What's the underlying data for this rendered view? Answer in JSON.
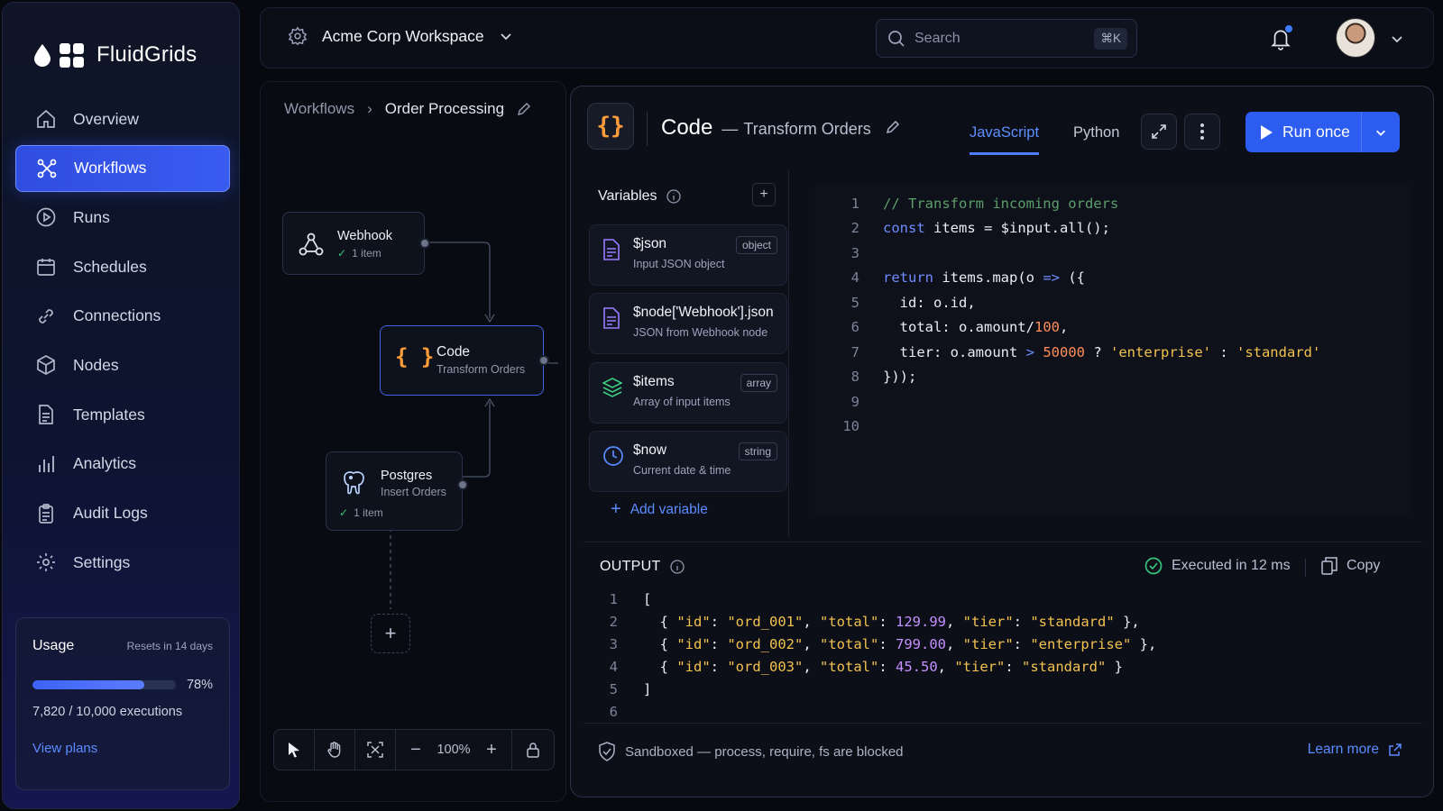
{
  "brand": {
    "name": "FluidGrids"
  },
  "sidebar": {
    "items": [
      {
        "label": "Overview",
        "icon": "home-icon"
      },
      {
        "label": "Workflows",
        "icon": "workflow-icon",
        "active": true
      },
      {
        "label": "Runs",
        "icon": "play-circle-icon"
      },
      {
        "label": "Schedules",
        "icon": "calendar-icon"
      },
      {
        "label": "Connections",
        "icon": "link-icon"
      },
      {
        "label": "Nodes",
        "icon": "cube-icon"
      },
      {
        "label": "Templates",
        "icon": "document-icon"
      },
      {
        "label": "Analytics",
        "icon": "bar-chart-icon"
      },
      {
        "label": "Audit Logs",
        "icon": "clipboard-icon"
      },
      {
        "label": "Settings",
        "icon": "gear-icon"
      }
    ]
  },
  "usage": {
    "title": "Usage",
    "reset": "Resets in 14 days",
    "percent_label": "78%",
    "percent": 0.78,
    "count": "7,820 / 10,000 executions",
    "link": "View plans"
  },
  "topbar": {
    "workspace": "Acme Corp Workspace",
    "search_placeholder": "Search",
    "shortcut": "⌘K"
  },
  "canvas": {
    "breadcrumb": {
      "root": "Workflows",
      "current": "Order Processing"
    },
    "nodes": {
      "webhook": {
        "title": "Webhook",
        "status": "1 item"
      },
      "code": {
        "title": "Code",
        "subtitle": "Transform Orders"
      },
      "postgres": {
        "title": "Postgres",
        "subtitle": "Insert Orders",
        "status": "1 item"
      }
    },
    "zoom": "100%"
  },
  "panel": {
    "title": "Code",
    "dash": "—",
    "subtitle": "Transform Orders",
    "tabs": [
      {
        "label": "JavaScript",
        "active": true
      },
      {
        "label": "Python"
      }
    ],
    "run_label": "Run once",
    "variables": {
      "title": "Variables",
      "items": [
        {
          "name": "$json",
          "desc": "Input JSON object",
          "type": "object",
          "icon": "document-icon"
        },
        {
          "name": "$node['Webhook'].json",
          "desc": "JSON from Webhook node",
          "type": "",
          "icon": "document-icon"
        },
        {
          "name": "$items",
          "desc": "Array of input items",
          "type": "array",
          "icon": "layers-icon"
        },
        {
          "name": "$now",
          "desc": "Current date & time",
          "type": "string",
          "icon": "clock-icon"
        }
      ],
      "add_label": "Add variable"
    },
    "code_lines": [
      "// Transform incoming orders",
      "const items = $input.all();",
      "",
      "return items.map(o => ({",
      "  id: o.id,",
      "  total: o.amount/100,",
      "  tier: o.amount > 50000 ? 'enterprise' : 'standard'",
      "}));",
      "",
      ""
    ],
    "output": {
      "title": "OUTPUT",
      "exec": "Executed in 12 ms",
      "copy": "Copy",
      "lines": [
        "[",
        "  { \"id\": \"ord_001\", \"total\": 129.99, \"tier\": \"standard\" },",
        "  { \"id\": \"ord_002\", \"total\": 799.00, \"tier\": \"enterprise\" },",
        "  { \"id\": \"ord_003\", \"total\": 45.50, \"tier\": \"standard\" }",
        "]",
        ""
      ]
    },
    "footer": {
      "sandbox": "Sandboxed — process, require, fs are blocked",
      "learn": "Learn more"
    }
  },
  "colors": {
    "accent": "#2c5cf0",
    "link": "#5b8cff",
    "code_icon": "#ff9d3a",
    "success": "#36c47a"
  }
}
